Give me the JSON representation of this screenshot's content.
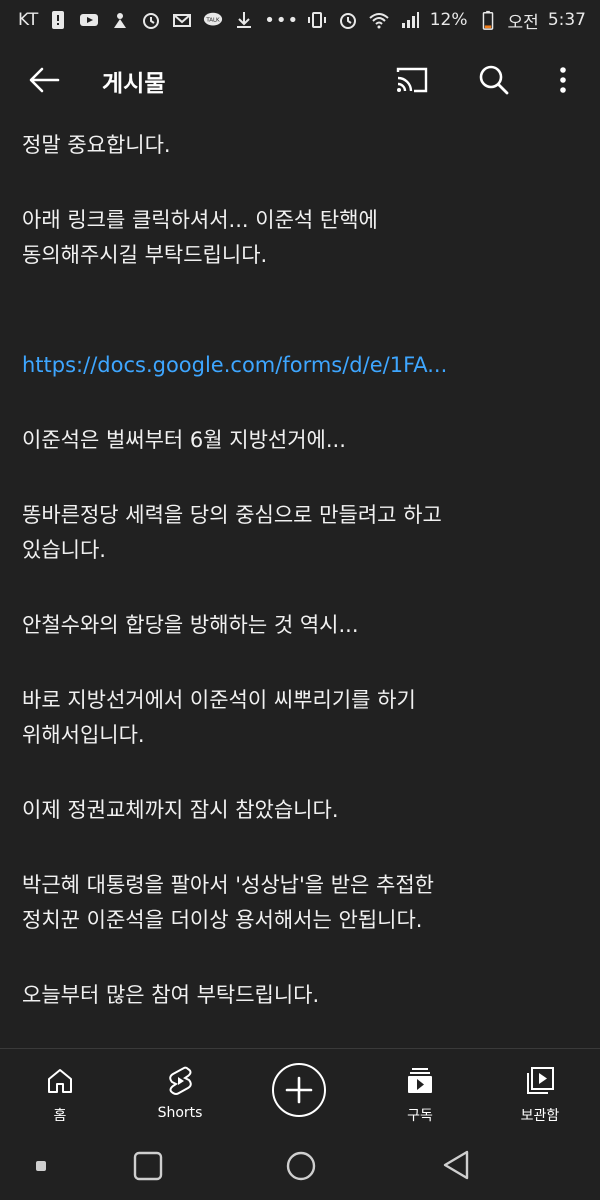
{
  "status_bar": {
    "carrier": "KT",
    "more": "•••",
    "battery": "12%",
    "ampm": "오전",
    "time": "5:37"
  },
  "app_bar": {
    "title": "게시물",
    "icons": [
      "back-arrow-icon",
      "cast-icon",
      "search-icon",
      "more-vert-icon"
    ]
  },
  "post": {
    "paragraphs": [
      "정말 중요합니다.",
      "아래 링크를 클릭하셔서... 이준석 탄핵에\n동의해주시길 부탁드립니다."
    ],
    "link": "https://docs.google.com/forms/d/e/1FA...",
    "paragraphs_after": [
      "이준석은 벌써부터 6월 지방선거에...",
      "똥바른정당 세력을 당의 중심으로 만들려고 하고\n있습니다.",
      "안철수와의 합당을 방해하는 것 역시...",
      "바로 지방선거에서 이준석이 씨뿌리기를 하기\n위해서입니다.",
      "이제 정권교체까지 잠시 참았습니다.",
      "박근혜 대통령을 팔아서 '성상납'을 받은 추접한\n정치꾼 이준석을 더이상 용서해서는 안됩니다.",
      "오늘부터 많은 참여 부탁드립니다."
    ]
  },
  "bottom_nav": {
    "home": "홈",
    "shorts": "Shorts",
    "subscriptions": "구독",
    "library": "보관함"
  },
  "colors": {
    "background": "#212121",
    "link": "#3ea6ff",
    "text": "#f1f1f1"
  }
}
